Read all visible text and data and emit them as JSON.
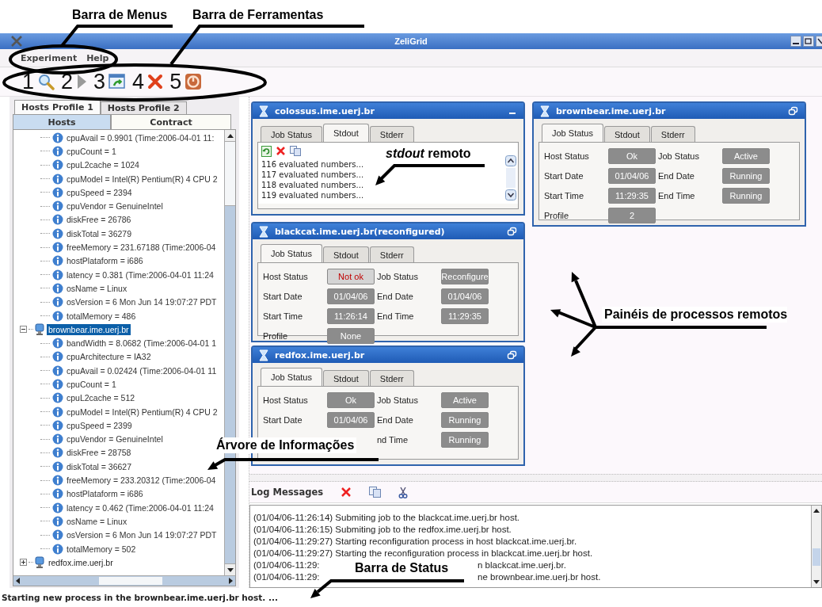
{
  "window": {
    "title": "ZeliGrid"
  },
  "menu": [
    "Experiment",
    "Help"
  ],
  "toolbar": [
    {
      "number": "1",
      "kind": "search"
    },
    {
      "number": "2",
      "kind": "run"
    },
    {
      "number": "3",
      "kind": "window"
    },
    {
      "number": "4",
      "kind": "cancel"
    },
    {
      "number": "5",
      "kind": "power"
    }
  ],
  "profile_tabs": [
    {
      "label": "Hosts Profile 1",
      "selected": true
    },
    {
      "label": "Hosts Profile 2",
      "selected": false
    }
  ],
  "view_tabs": [
    {
      "label": "Hosts",
      "selected": true
    },
    {
      "label": "Contract",
      "selected": false
    }
  ],
  "tree": [
    {
      "children": [
        {
          "text": "cpuAvail = 0.9901 (Time:2006-04-01 11:",
          "selected": false
        },
        {
          "text": "cpuCount = 1",
          "selected": false
        },
        {
          "text": "cpuL2cache = 1024",
          "selected": false
        },
        {
          "text": "cpuModel = Intel(R) Pentium(R) 4 CPU 2",
          "selected": false
        },
        {
          "text": "cpuSpeed = 2394",
          "selected": false
        },
        {
          "text": "cpuVendor = GenuineIntel",
          "selected": false
        },
        {
          "text": "diskFree = 26786",
          "selected": false
        },
        {
          "text": "diskTotal = 36279",
          "selected": false
        },
        {
          "text": "freeMemory = 231.67188 (Time:2006-04",
          "selected": false
        },
        {
          "text": "hostPlataform = i686",
          "selected": false
        },
        {
          "text": "latency = 0.381 (Time:2006-04-01 11:24",
          "selected": false
        },
        {
          "text": "osName = Linux",
          "selected": false
        },
        {
          "text": "osVersion = 6 Mon Jun 14 19:07:27 PDT",
          "selected": false
        },
        {
          "text": "totalMemory = 486",
          "selected": false
        }
      ]
    },
    {
      "label": "brownbear.ime.uerj.br",
      "expanded": true,
      "selected": true,
      "children": [
        {
          "text": "bandWidth = 8.0682 (Time:2006-04-01 1",
          "selected": false
        },
        {
          "text": "cpuArchitecture = IA32",
          "selected": false
        },
        {
          "text": "cpuAvail = 0.02424 (Time:2006-04-01 11",
          "selected": false
        },
        {
          "text": "cpuCount = 1",
          "selected": false
        },
        {
          "text": "cpuL2cache = 512",
          "selected": false
        },
        {
          "text": "cpuModel = Intel(R) Pentium(R) 4 CPU 2",
          "selected": false
        },
        {
          "text": "cpuSpeed = 2399",
          "selected": false
        },
        {
          "text": "cpuVendor = GenuineIntel",
          "selected": false
        },
        {
          "text": "diskFree = 28758",
          "selected": false
        },
        {
          "text": "diskTotal = 36627",
          "selected": false
        },
        {
          "text": "freeMemory = 233.20312 (Time:2006-04",
          "selected": false
        },
        {
          "text": "hostPlataform = i686",
          "selected": false
        },
        {
          "text": "latency = 0.462 (Time:2006-04-01 11:24",
          "selected": false
        },
        {
          "text": "osName = Linux",
          "selected": false
        },
        {
          "text": "osVersion = 6 Mon Jun 14 19:07:27 PDT",
          "selected": false
        },
        {
          "text": "totalMemory = 502",
          "selected": false
        }
      ]
    },
    {
      "label": "redfox.ime.uerj.br",
      "expanded": false,
      "selected": false
    }
  ],
  "panels": [
    {
      "title": "colossus.ime.uerj.br",
      "restorable": false,
      "kind": "stdout",
      "tabs": [
        {
          "label": "Job Status",
          "selected": false
        },
        {
          "label": "Stdout",
          "selected": true
        },
        {
          "label": "Stderr",
          "selected": false
        }
      ],
      "lines": [
        "116 evaluated numbers...",
        "117 evaluated numbers...",
        "118 evaluated numbers...",
        "119 evaluated numbers..."
      ]
    },
    {
      "title": "brownbear.ime.uerj.br",
      "restorable": true,
      "kind": "status",
      "tabs": [
        {
          "label": "Job Status",
          "selected": true
        },
        {
          "label": "Stdout",
          "selected": false
        },
        {
          "label": "Stderr",
          "selected": false
        }
      ],
      "rows": [
        [
          {
            "label": "Host Status",
            "value": "Ok",
            "alert": false
          },
          {
            "label": "Job Status",
            "value": "Active",
            "alert": false
          }
        ],
        [
          {
            "label": "Start Date",
            "value": "01/04/06",
            "alert": false
          },
          {
            "label": "End Date",
            "value": "Running",
            "alert": false
          }
        ],
        [
          {
            "label": "Start Time",
            "value": "11:29:35",
            "alert": false
          },
          {
            "label": "End Time",
            "value": "Running",
            "alert": false
          }
        ],
        [
          {
            "label": "Profile",
            "value": "2",
            "alert": false
          }
        ]
      ]
    },
    {
      "title": "blackcat.ime.uerj.br(reconfigured)",
      "restorable": true,
      "kind": "status",
      "tabs": [
        {
          "label": "Job Status",
          "selected": true
        },
        {
          "label": "Stdout",
          "selected": false
        },
        {
          "label": "Stderr",
          "selected": false
        }
      ],
      "rows": [
        [
          {
            "label": "Host Status",
            "value": "Not ok",
            "alert": true
          },
          {
            "label": "Job Status",
            "value": "Reconfigure",
            "alert": false
          }
        ],
        [
          {
            "label": "Start Date",
            "value": "01/04/06",
            "alert": false
          },
          {
            "label": "End Date",
            "value": "01/04/06",
            "alert": false
          }
        ],
        [
          {
            "label": "Start Time",
            "value": "11:26:14",
            "alert": false
          },
          {
            "label": "End Time",
            "value": "11:29:35",
            "alert": false
          }
        ],
        [
          {
            "label": "Profile",
            "value": "None",
            "alert": false
          }
        ]
      ]
    },
    {
      "title": "redfox.ime.uerj.br",
      "restorable": true,
      "kind": "status",
      "tabs": [
        {
          "label": "Job Status",
          "selected": true
        },
        {
          "label": "Stdout",
          "selected": false
        },
        {
          "label": "Stderr",
          "selected": false
        }
      ],
      "rows": [
        [
          {
            "label": "Host Status",
            "value": "Ok",
            "alert": false
          },
          {
            "label": "Job Status",
            "value": "Active",
            "alert": false
          }
        ],
        [
          {
            "label": "Start Date",
            "value": "01/04/06",
            "alert": false
          },
          {
            "label": "End Date",
            "value": "Running",
            "alert": false
          }
        ],
        [
          null,
          {
            "label": "nd Time",
            "value": "Running",
            "alert": false
          }
        ]
      ]
    }
  ],
  "log": {
    "title": "Log Messages",
    "lines": [
      {
        "parts": [
          "(01/04/06-11:26:14) Submiting job to the blackcat.ime.uerj.br host."
        ]
      },
      {
        "parts": [
          "(01/04/06-11:26:15) Submiting job to the redfox.ime.uerj.br host."
        ]
      },
      {
        "parts": [
          "(01/04/06-11:29:27) Starting reconfiguration process in host blackcat.ime.uerj.br."
        ]
      },
      {
        "parts": [
          "(01/04/06-11:29:27) Starting the reconfiguration process in blackcat.ime.uerj.br host."
        ]
      },
      {
        "parts": [
          "(01/04/06-11:29:",
          "n blackcat.ime.uerj.br."
        ]
      },
      {
        "parts": [
          "(01/04/06-11:29:",
          "ne brownbear.ime.uerj.br host."
        ]
      }
    ]
  },
  "status_bar": "Starting new process in the brownbear.ime.uerj.br host. ...",
  "annotations": [
    {
      "kind": "menus",
      "text": "Barra de Menus"
    },
    {
      "kind": "toolbar",
      "text": "Barra de Ferramentas"
    },
    {
      "kind": "stdout",
      "text": "*stdout* remoto"
    },
    {
      "kind": "panels",
      "text": "Painéis de processos remotos"
    },
    {
      "kind": "tree",
      "text": "Árvore de Informações"
    },
    {
      "kind": "status",
      "text": "Barra de Status"
    }
  ]
}
